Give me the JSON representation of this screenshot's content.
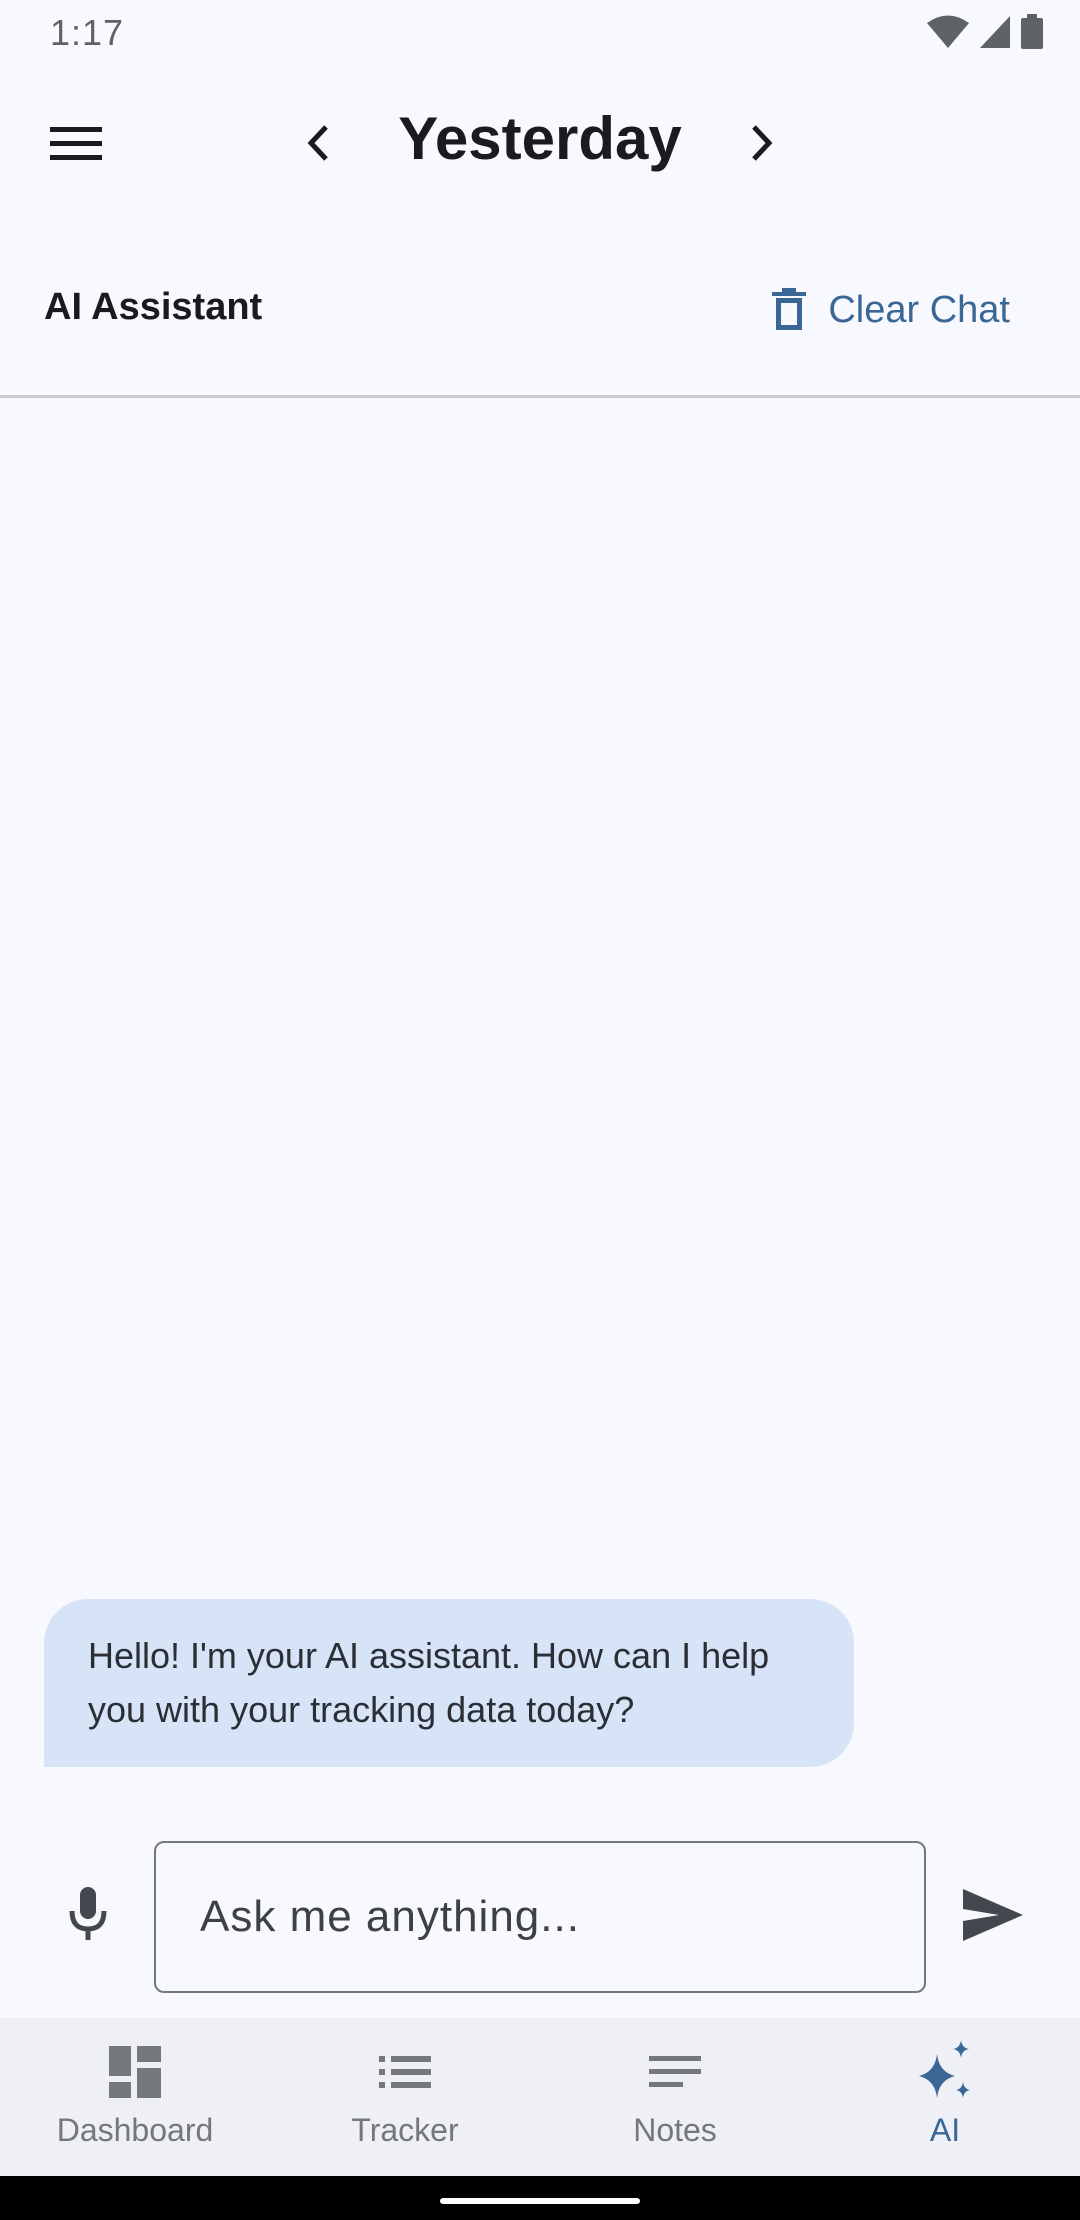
{
  "status_bar": {
    "time": "1:17",
    "icons": [
      "wifi-icon",
      "cellular-signal-icon",
      "battery-icon"
    ]
  },
  "top_bar": {
    "title": "Yesterday",
    "menu_icon": "menu-icon",
    "prev_icon": "chevron-left-icon",
    "next_icon": "chevron-right-icon"
  },
  "chat_header": {
    "title": "AI Assistant",
    "clear_label": "Clear Chat",
    "clear_icon": "trash-icon"
  },
  "messages": [
    {
      "sender": "assistant",
      "text": "Hello! I'm your AI assistant. How can I help you with your tracking data today?"
    }
  ],
  "composer": {
    "placeholder": "Ask me anything...",
    "value": "",
    "mic_icon": "microphone-icon",
    "send_icon": "send-icon"
  },
  "bottom_nav": {
    "items": [
      {
        "label": "Dashboard",
        "icon": "dashboard-icon",
        "active": false
      },
      {
        "label": "Tracker",
        "icon": "list-icon",
        "active": false
      },
      {
        "label": "Notes",
        "icon": "notes-icon",
        "active": false
      },
      {
        "label": "AI",
        "icon": "sparkle-icon",
        "active": true
      }
    ]
  },
  "colors": {
    "background": "#f8f9fe",
    "accent": "#3a6796",
    "bubble": "#d7e3f6",
    "nav_background": "#eef0f6",
    "inactive": "#74777c"
  }
}
